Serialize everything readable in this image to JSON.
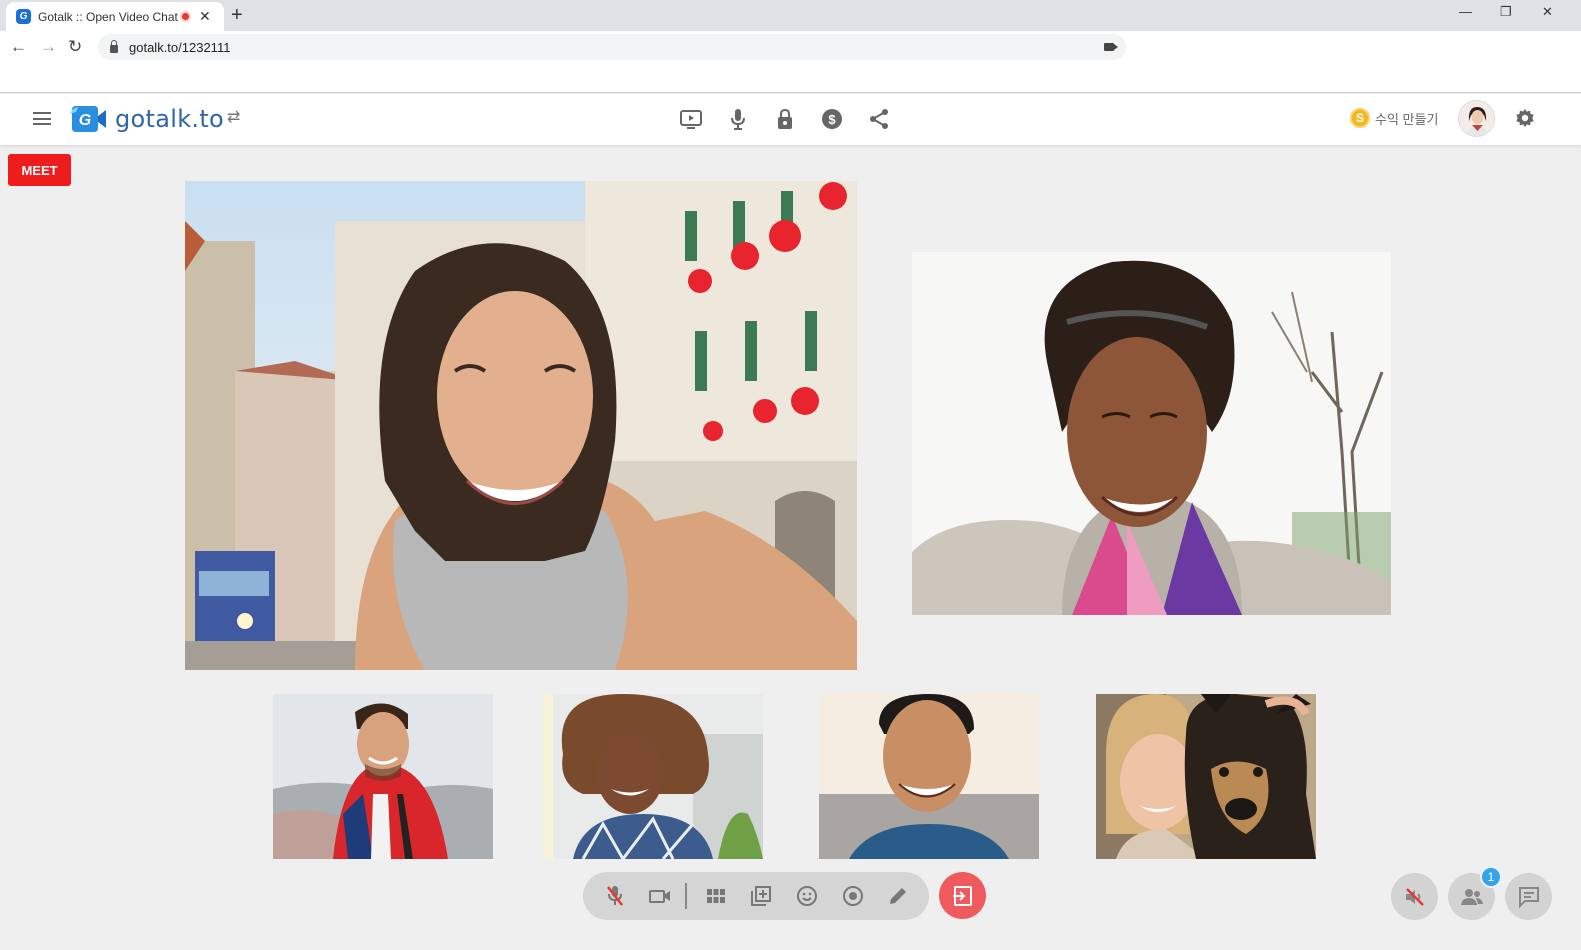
{
  "browser": {
    "tab_title": "Gotalk :: Open Video Chat",
    "favicon_letter": "G",
    "new_tab": "+",
    "url": "gotalk.to/1232111"
  },
  "app": {
    "logo_text": "gotalk.to",
    "logo_letter": "G",
    "earn_label": "수익 만들기",
    "coin_symbol": "S",
    "meet_label": "MEET",
    "participants_count": "1",
    "accent_color": "#2f66a8",
    "leave_color": "#ef5a5f",
    "meet_color": "#ee1c1c"
  },
  "icons": {
    "header_center": [
      "screen-share-icon",
      "microphone-icon",
      "lock-icon",
      "dollar-icon",
      "share-icon"
    ],
    "control_bar": [
      "mic-off-icon",
      "camera-icon",
      "grid-layout-icon",
      "add-window-icon",
      "emoji-icon",
      "record-icon",
      "pen-icon",
      "exit-icon"
    ],
    "right_controls": [
      "speaker-off-icon",
      "participants-icon",
      "chat-icon"
    ]
  },
  "videos": [
    {
      "id": "main-1"
    },
    {
      "id": "main-2"
    },
    {
      "id": "small-1"
    },
    {
      "id": "small-2"
    },
    {
      "id": "small-3"
    },
    {
      "id": "small-4"
    }
  ]
}
